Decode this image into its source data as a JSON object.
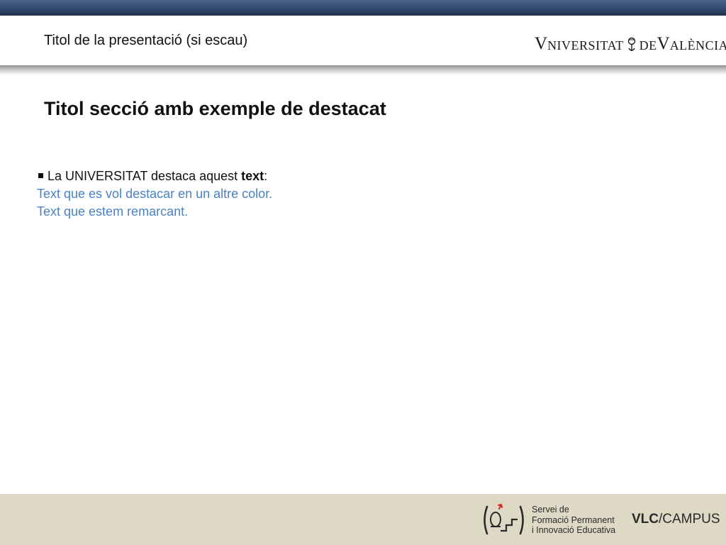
{
  "header": {
    "presentation_title": "Titol de la presentació (si escau)",
    "logo": {
      "part1_big": "V",
      "part1_small": "NIVERSITAT",
      "part2_big": "V",
      "part2_small": "ALÈNCIA",
      "seal_letters": "DE",
      "seal_icon": "university-seal-icon"
    }
  },
  "main": {
    "section_title": "Titol secció amb exemple de destacat",
    "bullet": {
      "prefix": "La UNIVERSITAT destaca aquest ",
      "bold": "text",
      "suffix": ":"
    },
    "highlight_lines": [
      "Text que es vol destacar en un altre color.",
      "Text que estem remarcant."
    ]
  },
  "footer": {
    "service_icon": "sfpie-logo-icon",
    "service_lines": [
      "Servei de",
      "Formació Permanent",
      "i Innovació Educativa"
    ],
    "vlc": "VLC",
    "campus": "/CAMPUS"
  },
  "colors": {
    "top_bar": "#344a6e",
    "highlight_text": "#4a82c4",
    "footer_band": "#ddd9c4"
  }
}
